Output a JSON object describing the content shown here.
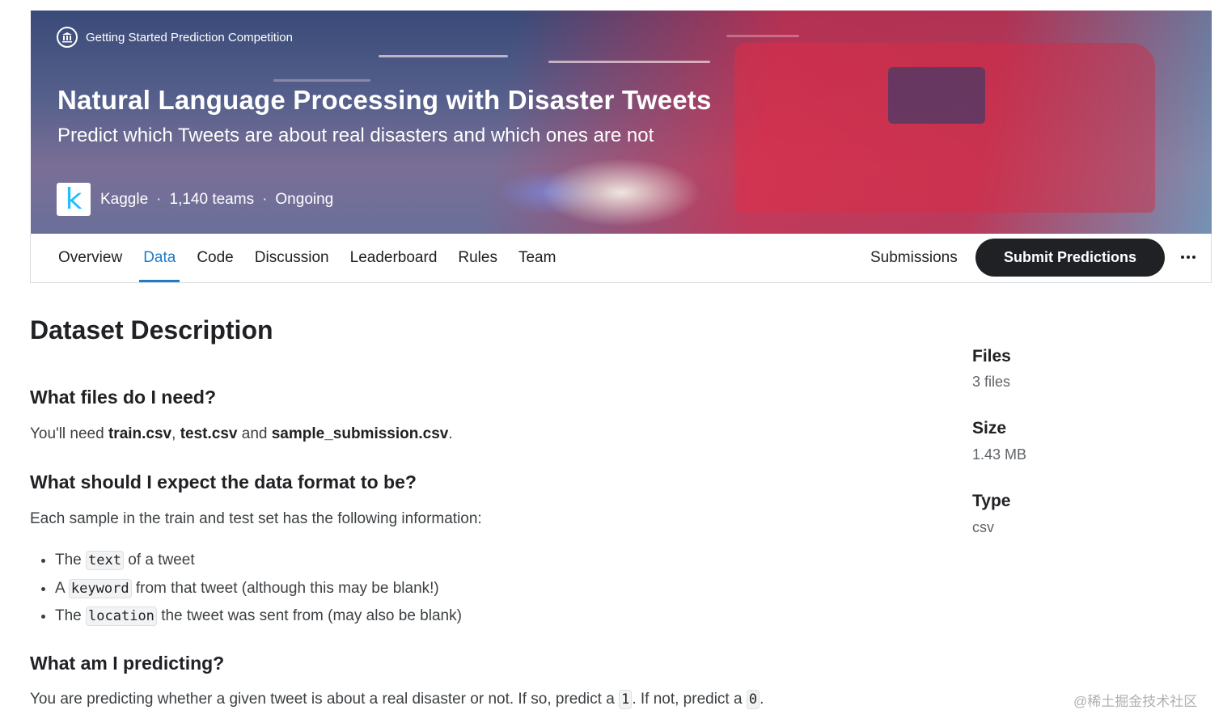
{
  "banner": {
    "competition_type": "Getting Started Prediction Competition",
    "title": "Natural Language Processing with Disaster Tweets",
    "subtitle": "Predict which Tweets are about real disasters and which ones are not",
    "host": "Kaggle",
    "teams": "1,140 teams",
    "status": "Ongoing",
    "separator": "·",
    "logo_letter": "k"
  },
  "nav": {
    "tabs": [
      {
        "label": "Overview",
        "active": false
      },
      {
        "label": "Data",
        "active": true
      },
      {
        "label": "Code",
        "active": false
      },
      {
        "label": "Discussion",
        "active": false
      },
      {
        "label": "Leaderboard",
        "active": false
      },
      {
        "label": "Rules",
        "active": false
      },
      {
        "label": "Team",
        "active": false
      }
    ],
    "submissions_label": "Submissions",
    "submit_label": "Submit Predictions"
  },
  "content": {
    "title": "Dataset Description",
    "sections": [
      {
        "heading": "What files do I need?"
      },
      {
        "heading": "What should I expect the data format to be?"
      },
      {
        "heading": "What am I predicting?"
      }
    ],
    "files_text": {
      "prefix": "You'll need ",
      "file1": "train.csv",
      "comma": ", ",
      "file2": "test.csv",
      "and": " and ",
      "file3": "sample_submission.csv",
      "period": "."
    },
    "format_text": "Each sample in the train and test set has the following information:",
    "list": [
      {
        "pre": "The ",
        "code": "text",
        "post": " of a tweet"
      },
      {
        "pre": "A ",
        "code": "keyword",
        "post": " from that tweet (although this may be blank!)"
      },
      {
        "pre": "The ",
        "code": "location",
        "post": " the tweet was sent from (may also be blank)"
      }
    ],
    "predict_text": {
      "pre": "You are predicting whether a given tweet is about a real disaster or not. If so, predict a ",
      "code1": "1",
      "mid": ". If not, predict a ",
      "code2": "0",
      "end": "."
    }
  },
  "sidebar": {
    "files_label": "Files",
    "files_value": "3 files",
    "size_label": "Size",
    "size_value": "1.43 MB",
    "type_label": "Type",
    "type_value": "csv"
  },
  "watermark": "@稀土掘金技术社区",
  "colors": {
    "accent": "#1e7bc8",
    "kaggle_blue": "#20beff",
    "button_bg": "#202124"
  }
}
